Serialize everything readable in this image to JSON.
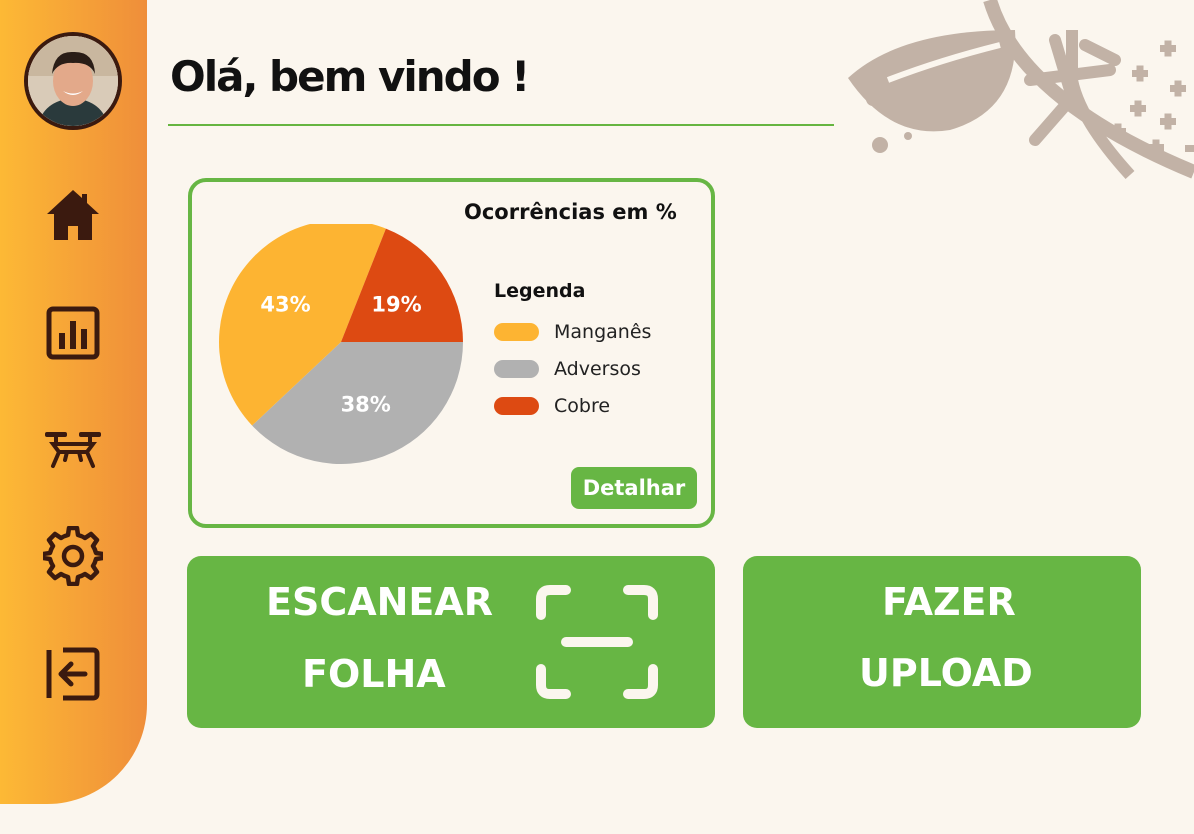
{
  "header": {
    "greeting": "Olá, bem vindo !"
  },
  "sidebar": {
    "items": [
      {
        "icon": "home-icon"
      },
      {
        "icon": "chart-report-icon"
      },
      {
        "icon": "drone-icon"
      },
      {
        "icon": "gear-icon"
      },
      {
        "icon": "logout-icon"
      }
    ]
  },
  "chart_data": {
    "type": "pie",
    "title": "Ocorrências em %",
    "legend_title": "Legenda",
    "categories": [
      "Manganês",
      "Adversos",
      "Cobre"
    ],
    "values": [
      43,
      38,
      19
    ],
    "labels": [
      "43%",
      "38%",
      "19%"
    ],
    "colors": [
      "#fdb432",
      "#b1b1b1",
      "#dd4a12"
    ],
    "legend_placement": "right"
  },
  "chart_card": {
    "detail_button": "Detalhar"
  },
  "actions": {
    "scan": {
      "line1": "ESCANEAR",
      "line2": "FOLHA"
    },
    "upload": {
      "line1": "FAZER",
      "line2": "UPLOAD"
    }
  },
  "colors": {
    "accent": "#67b644",
    "sidebar_top": "#fdb935",
    "sidebar_bottom": "#ef8e3a",
    "icon": "#3b1a0f"
  }
}
